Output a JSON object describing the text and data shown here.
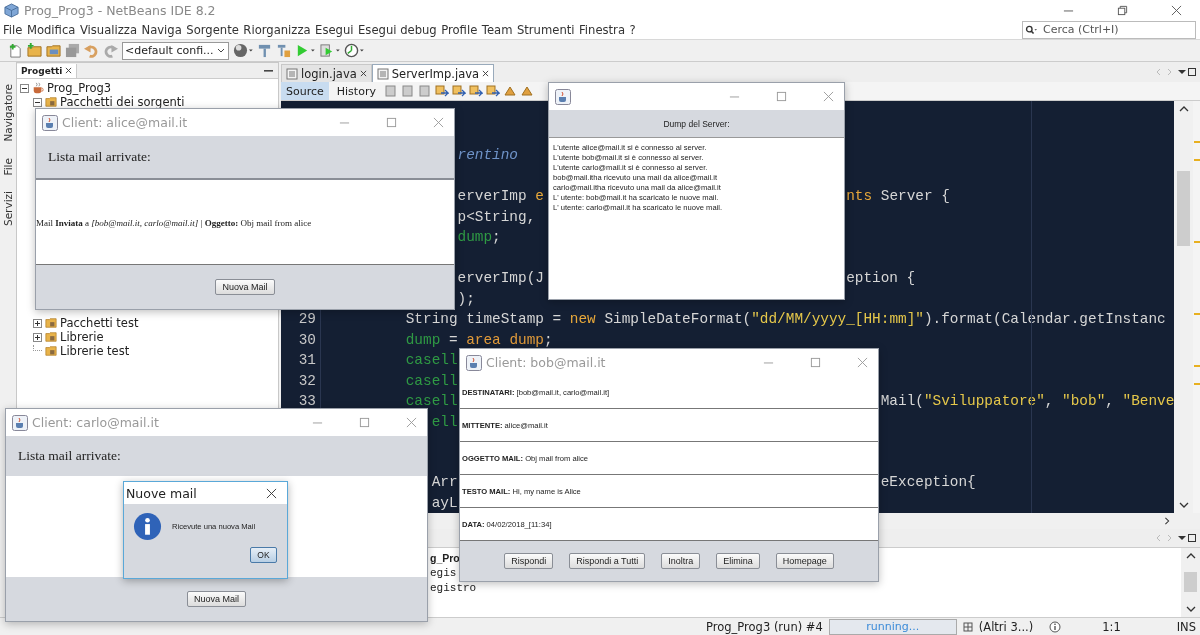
{
  "window": {
    "title": "Prog_Prog3 - NetBeans IDE 8.2"
  },
  "menu": [
    "File",
    "Modifica",
    "Visualizza",
    "Naviga",
    "Sorgente",
    "Riorganizza",
    "Esegui",
    "Esegui debug",
    "Profile",
    "Team",
    "Strumenti",
    "Finestra",
    "?"
  ],
  "search": {
    "placeholder": "Cerca (Ctrl+I)"
  },
  "toolbar": {
    "configuration": "<default confi..."
  },
  "side_tabs": [
    "Navigatore",
    "File",
    "Servizi"
  ],
  "projects": {
    "tab": "Progetti",
    "tree": [
      {
        "label": "Prog_Prog3",
        "expanded": true,
        "children": [
          {
            "label": "Pacchetti dei sorgenti",
            "expanded": true
          },
          {
            "label": "Pacchetti test",
            "expanded": false
          },
          {
            "label": "Librerie",
            "expanded": false
          },
          {
            "label": "Librerie test"
          }
        ]
      }
    ]
  },
  "editor": {
    "tabs": [
      {
        "label": "login.java",
        "selected": false
      },
      {
        "label": "ServerImp.java",
        "selected": true
      }
    ],
    "views": [
      {
        "label": "Source",
        "selected": true
      },
      {
        "label": "History",
        "selected": false
      }
    ],
    "lines": [
      {
        "segments": [
          {
            "kind": "comment",
            "text": "               rentino"
          }
        ]
      },
      {
        "blank_line_before": true,
        "segments": [
          {
            "kind": "plain",
            "text": "               erverImp "
          },
          {
            "kind": "keyword",
            "text": "e"
          },
          {
            "kind": "keyword",
            "text": "                                   nts"
          },
          {
            "kind": "plain",
            "text": " Server {"
          }
        ]
      },
      {
        "segments": [
          {
            "kind": "plain",
            "text": "               p<String,"
          }
        ]
      },
      {
        "segments": [
          {
            "kind": "field",
            "text": "               dump"
          },
          {
            "kind": "plain",
            "text": ";"
          }
        ]
      },
      {
        "blank_line_before": true,
        "segments": [
          {
            "kind": "plain",
            "text": "               erverImp(J"
          },
          {
            "kind": "plain",
            "text": "                                   eption {"
          }
        ]
      },
      {
        "segments": [
          {
            "kind": "plain",
            "text": "               );"
          }
        ]
      },
      {
        "number": "29",
        "segments": [
          {
            "kind": "plain",
            "text": "         String timeStamp = "
          },
          {
            "kind": "keyword",
            "text": "new"
          },
          {
            "kind": "plain",
            "text": " SimpleDateFormat("
          },
          {
            "kind": "string",
            "text": "\"dd/MM/yyyy_[HH:mm]\""
          },
          {
            "kind": "plain",
            "text": ").format(Calendar.getInstanc"
          }
        ]
      },
      {
        "number": "30",
        "segments": [
          {
            "kind": "field",
            "text": "         dump"
          },
          {
            "kind": "plain",
            "text": " = "
          },
          {
            "kind": "param",
            "text": "area dump"
          },
          {
            "kind": "plain",
            "text": ";"
          }
        ]
      },
      {
        "number": "31",
        "segments": [
          {
            "kind": "field",
            "text": "         casell"
          }
        ]
      },
      {
        "number": "32",
        "segments": [
          {
            "kind": "field",
            "text": "         casell"
          }
        ]
      },
      {
        "number": "33",
        "segments": [
          {
            "kind": "field",
            "text": "         casell"
          },
          {
            "kind": "plain",
            "text": "                                                 Mail("
          },
          {
            "kind": "string",
            "text": "\"Sviluppatore\""
          },
          {
            "kind": "plain",
            "text": ", "
          },
          {
            "kind": "string",
            "text": "\"bob\""
          },
          {
            "kind": "plain",
            "text": ", "
          },
          {
            "kind": "string",
            "text": "\"Benve"
          }
        ]
      },
      {
        "segments": [
          {
            "kind": "field",
            "text": "            ell"
          }
        ]
      }
    ],
    "bottom_lines": [
      {
        "segments": [
          {
            "kind": "plain",
            "text": "            Arr"
          },
          {
            "kind": "plain",
            "text": "                                                 eException{"
          }
        ]
      },
      {
        "segments": [
          {
            "kind": "plain",
            "text": "            ayL"
          }
        ]
      }
    ]
  },
  "output": {
    "tab": "g_Pro",
    "lines": [
      "egis",
      "egistro"
    ]
  },
  "status_bar": {
    "project": "Prog_Prog3 (run) #4",
    "progress": "running...",
    "tasks": "(Altri 3...)",
    "position": "1:1",
    "mode": "INS"
  },
  "alice_client": {
    "title": "Client: alice@mail.it",
    "header": "Lista mail arrivate:",
    "mails": [
      "Mail **Inviata** a *[bob@mail.it, carlo@mail.it]* | **Oggetto:** Obj mail from alice"
    ],
    "button": "Nuova Mail"
  },
  "server_dump": {
    "header": "Dump del Server:",
    "log": [
      "L'utente alice@mail.it si è connesso al server.",
      "L'utente bob@mail.it si è connesso al server.",
      "L'utente carlo@mail.it si è connesso al server.",
      "bob@mail.itha ricevuto una mail da alice@mail.it",
      "carlo@mail.itha ricevuto una mail da alice@mail.it",
      "L' utente: bob@mail.it ha scaricato le nuove mail.",
      "L' utente: carlo@mail.it ha scaricato le nuove mail."
    ]
  },
  "carlo_client": {
    "title": "Client: carlo@mail.it",
    "header": "Lista mail arrivate:",
    "button": "Nuova Mail"
  },
  "dialog": {
    "title": "Nuove mail",
    "message": "Ricevute una nuova Mail",
    "button": "OK"
  },
  "bob_client": {
    "title": "Client: bob@mail.it",
    "fields": [
      {
        "label": "DESTINATARI:",
        "value": "[bob@mail.it, carlo@mail.it]"
      },
      {
        "label": "MITTENTE:",
        "value": "alice@mail.it"
      },
      {
        "label": "OGGETTO MAIL:",
        "value": "Obj mail from alice"
      },
      {
        "label": "TESTO MAIL:",
        "value": "Hi, my name is Alice"
      },
      {
        "label": "DATA:",
        "value": "04/02/2018_[11:34]"
      }
    ],
    "buttons": [
      "Rispondi",
      "Rispondi a Tutti",
      "Inoltra",
      "Elimina",
      "Homepage"
    ]
  }
}
